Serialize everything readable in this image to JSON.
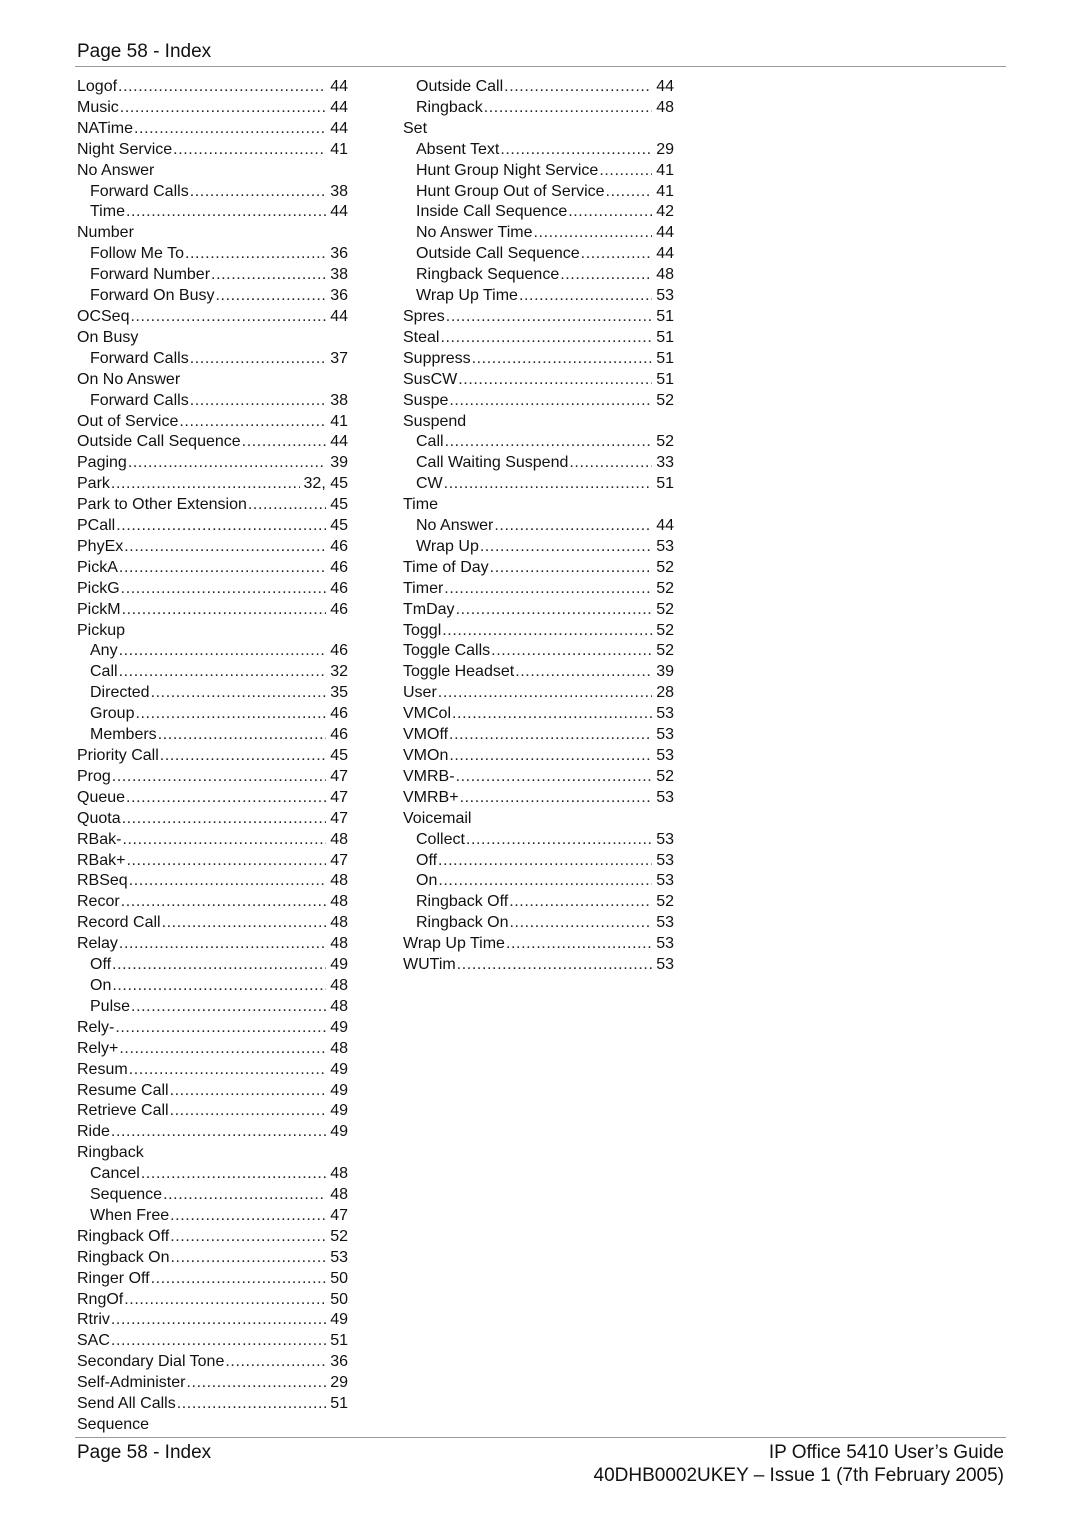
{
  "header": {
    "title": "Page 58 - Index"
  },
  "index": {
    "left_column": [
      {
        "term": "Logof",
        "page": "44",
        "level": 0
      },
      {
        "term": "Music",
        "page": "44",
        "level": 0
      },
      {
        "term": "NATime",
        "page": "44",
        "level": 0
      },
      {
        "term": "Night Service",
        "page": "41",
        "level": 0
      },
      {
        "term": "No Answer",
        "page": "",
        "level": 0
      },
      {
        "term": "Forward Calls",
        "page": "38",
        "level": 1
      },
      {
        "term": "Time",
        "page": "44",
        "level": 1
      },
      {
        "term": "Number",
        "page": "",
        "level": 0
      },
      {
        "term": "Follow Me To",
        "page": "36",
        "level": 1
      },
      {
        "term": "Forward Number",
        "page": "38",
        "level": 1
      },
      {
        "term": "Forward On Busy",
        "page": "36",
        "level": 1
      },
      {
        "term": "OCSeq",
        "page": "44",
        "level": 0
      },
      {
        "term": "On Busy",
        "page": "",
        "level": 0
      },
      {
        "term": "Forward Calls",
        "page": "37",
        "level": 1
      },
      {
        "term": "On No Answer",
        "page": "",
        "level": 0
      },
      {
        "term": "Forward Calls",
        "page": "38",
        "level": 1
      },
      {
        "term": "Out of Service",
        "page": "41",
        "level": 0
      },
      {
        "term": "Outside Call Sequence",
        "page": "44",
        "level": 0
      },
      {
        "term": "Paging",
        "page": "39",
        "level": 0
      },
      {
        "term": "Park",
        "page": "32, 45",
        "level": 0
      },
      {
        "term": "Park to Other Extension",
        "page": "45",
        "level": 0
      },
      {
        "term": "PCall",
        "page": "45",
        "level": 0
      },
      {
        "term": "PhyEx",
        "page": "46",
        "level": 0
      },
      {
        "term": "PickA",
        "page": "46",
        "level": 0
      },
      {
        "term": "PickG",
        "page": "46",
        "level": 0
      },
      {
        "term": "PickM",
        "page": "46",
        "level": 0
      },
      {
        "term": "Pickup",
        "page": "",
        "level": 0
      },
      {
        "term": "Any",
        "page": "46",
        "level": 1
      },
      {
        "term": "Call",
        "page": "32",
        "level": 1
      },
      {
        "term": "Directed",
        "page": "35",
        "level": 1
      },
      {
        "term": "Group",
        "page": "46",
        "level": 1
      },
      {
        "term": "Members",
        "page": "46",
        "level": 1
      },
      {
        "term": "Priority Call",
        "page": "45",
        "level": 0
      },
      {
        "term": "Prog",
        "page": "47",
        "level": 0
      },
      {
        "term": "Queue",
        "page": "47",
        "level": 0
      },
      {
        "term": "Quota",
        "page": "47",
        "level": 0
      },
      {
        "term": "RBak-",
        "page": "48",
        "level": 0
      },
      {
        "term": "RBak+",
        "page": "47",
        "level": 0
      },
      {
        "term": "RBSeq",
        "page": "48",
        "level": 0
      },
      {
        "term": "Recor",
        "page": "48",
        "level": 0
      },
      {
        "term": "Record Call",
        "page": "48",
        "level": 0
      },
      {
        "term": "Relay",
        "page": "48",
        "level": 0
      },
      {
        "term": "Off",
        "page": "49",
        "level": 1
      },
      {
        "term": "On",
        "page": "48",
        "level": 1
      },
      {
        "term": "Pulse",
        "page": "48",
        "level": 1
      },
      {
        "term": "Rely-",
        "page": "49",
        "level": 0
      },
      {
        "term": "Rely+",
        "page": "48",
        "level": 0
      },
      {
        "term": "Resum",
        "page": "49",
        "level": 0
      },
      {
        "term": "Resume Call",
        "page": "49",
        "level": 0
      },
      {
        "term": "Retrieve Call",
        "page": "49",
        "level": 0
      },
      {
        "term": "Ride",
        "page": "49",
        "level": 0
      },
      {
        "term": "Ringback",
        "page": "",
        "level": 0
      },
      {
        "term": "Cancel",
        "page": "48",
        "level": 1
      },
      {
        "term": "Sequence",
        "page": "48",
        "level": 1
      },
      {
        "term": "When Free",
        "page": "47",
        "level": 1
      },
      {
        "term": "Ringback Off",
        "page": "52",
        "level": 0
      },
      {
        "term": "Ringback On",
        "page": "53",
        "level": 0
      },
      {
        "term": "Ringer Off",
        "page": "50",
        "level": 0
      },
      {
        "term": "RngOf",
        "page": "50",
        "level": 0
      },
      {
        "term": "Rtriv",
        "page": "49",
        "level": 0
      },
      {
        "term": "SAC",
        "page": "51",
        "level": 0
      },
      {
        "term": "Secondary Dial Tone",
        "page": "36",
        "level": 0
      },
      {
        "term": "Self-Administer",
        "page": "29",
        "level": 0
      },
      {
        "term": "Send All Calls",
        "page": "51",
        "level": 0
      },
      {
        "term": "Sequence",
        "page": "",
        "level": 0
      }
    ],
    "right_column": [
      {
        "term": "Outside Call",
        "page": "44",
        "level": 1
      },
      {
        "term": "Ringback",
        "page": "48",
        "level": 1
      },
      {
        "term": "Set",
        "page": "",
        "level": 0
      },
      {
        "term": "Absent Text",
        "page": "29",
        "level": 1
      },
      {
        "term": "Hunt Group Night Service",
        "page": "41",
        "level": 1
      },
      {
        "term": "Hunt Group Out of Service",
        "page": "41",
        "level": 1
      },
      {
        "term": "Inside Call Sequence",
        "page": "42",
        "level": 1
      },
      {
        "term": "No Answer Time",
        "page": "44",
        "level": 1
      },
      {
        "term": "Outside Call Sequence",
        "page": "44",
        "level": 1
      },
      {
        "term": "Ringback Sequence",
        "page": "48",
        "level": 1
      },
      {
        "term": "Wrap Up Time",
        "page": "53",
        "level": 1
      },
      {
        "term": "Spres",
        "page": "51",
        "level": 0
      },
      {
        "term": "Steal",
        "page": "51",
        "level": 0
      },
      {
        "term": "Suppress",
        "page": "51",
        "level": 0
      },
      {
        "term": "SusCW",
        "page": "51",
        "level": 0
      },
      {
        "term": "Suspe",
        "page": "52",
        "level": 0
      },
      {
        "term": "Suspend",
        "page": "",
        "level": 0
      },
      {
        "term": "Call",
        "page": "52",
        "level": 1
      },
      {
        "term": "Call Waiting Suspend",
        "page": "33",
        "level": 1
      },
      {
        "term": "CW",
        "page": "51",
        "level": 1
      },
      {
        "term": "Time",
        "page": "",
        "level": 0
      },
      {
        "term": "No Answer",
        "page": "44",
        "level": 1
      },
      {
        "term": "Wrap Up",
        "page": "53",
        "level": 1
      },
      {
        "term": "Time of Day",
        "page": "52",
        "level": 0
      },
      {
        "term": "Timer",
        "page": "52",
        "level": 0
      },
      {
        "term": "TmDay",
        "page": "52",
        "level": 0
      },
      {
        "term": "Toggl",
        "page": "52",
        "level": 0
      },
      {
        "term": "Toggle Calls",
        "page": "52",
        "level": 0
      },
      {
        "term": "Toggle Headset",
        "page": "39",
        "level": 0
      },
      {
        "term": "User",
        "page": "28",
        "level": 0
      },
      {
        "term": "VMCol",
        "page": "53",
        "level": 0
      },
      {
        "term": "VMOff",
        "page": "53",
        "level": 0
      },
      {
        "term": "VMOn",
        "page": "53",
        "level": 0
      },
      {
        "term": "VMRB-",
        "page": "52",
        "level": 0
      },
      {
        "term": "VMRB+",
        "page": "53",
        "level": 0
      },
      {
        "term": "Voicemail",
        "page": "",
        "level": 0
      },
      {
        "term": "Collect",
        "page": "53",
        "level": 1
      },
      {
        "term": "Off",
        "page": "53",
        "level": 1
      },
      {
        "term": "On",
        "page": "53",
        "level": 1
      },
      {
        "term": "Ringback Off",
        "page": "52",
        "level": 1
      },
      {
        "term": "Ringback On",
        "page": "53",
        "level": 1
      },
      {
        "term": "Wrap Up Time",
        "page": "53",
        "level": 0
      },
      {
        "term": "WUTim",
        "page": "53",
        "level": 0
      }
    ]
  },
  "footer": {
    "left": "Page 58 - Index",
    "right_line1": "IP Office 5410 User’s Guide",
    "right_line2": "40DHB0002UKEY – Issue 1 (7th February 2005)"
  }
}
